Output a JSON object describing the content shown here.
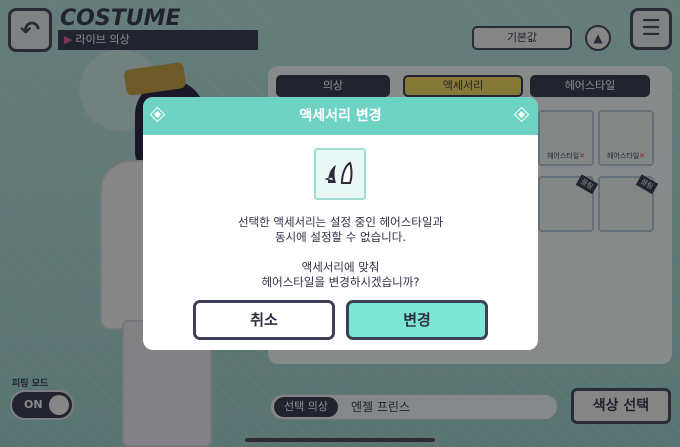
{
  "screen": {
    "title": "COSTUME",
    "subtitle_arrow": "▶",
    "subtitle": "라이브 의상"
  },
  "toolbar": {
    "default_label": "기본값",
    "up_icon": "▲",
    "menu_icon": "☰",
    "back_icon": "↶"
  },
  "tabs": [
    {
      "label": "의상",
      "active": false
    },
    {
      "label": "액세서리",
      "active": true
    },
    {
      "label": "헤어스타일",
      "active": false
    }
  ],
  "items": [
    {
      "label": "헤어스타일",
      "mark": "✕"
    },
    {
      "label": "헤어스타일",
      "mark": "✕"
    },
    {
      "badge": "끌림"
    },
    {
      "badge": "끌림"
    }
  ],
  "bottom": {
    "outfit_label": "선택 의상",
    "outfit_value": "엔젤 프린스",
    "color_button": "색상 선택",
    "fitting_label": "피팅 모드",
    "toggle_text": "ON"
  },
  "dialog": {
    "title": "액세서리 변경",
    "message_line1": "선택한 액세서리는 설정 중인 헤어스타일과",
    "message_line2": "동시에 설정할 수 없습니다.",
    "message_line3": "액세서리에 맞춰",
    "message_line4": "헤어스타일을 변경하시겠습니까?",
    "cancel_label": "취소",
    "confirm_label": "변경"
  },
  "colors": {
    "accent": "#6ed3c2",
    "dark": "#3d4057",
    "tab_active": "#f5dc66"
  }
}
